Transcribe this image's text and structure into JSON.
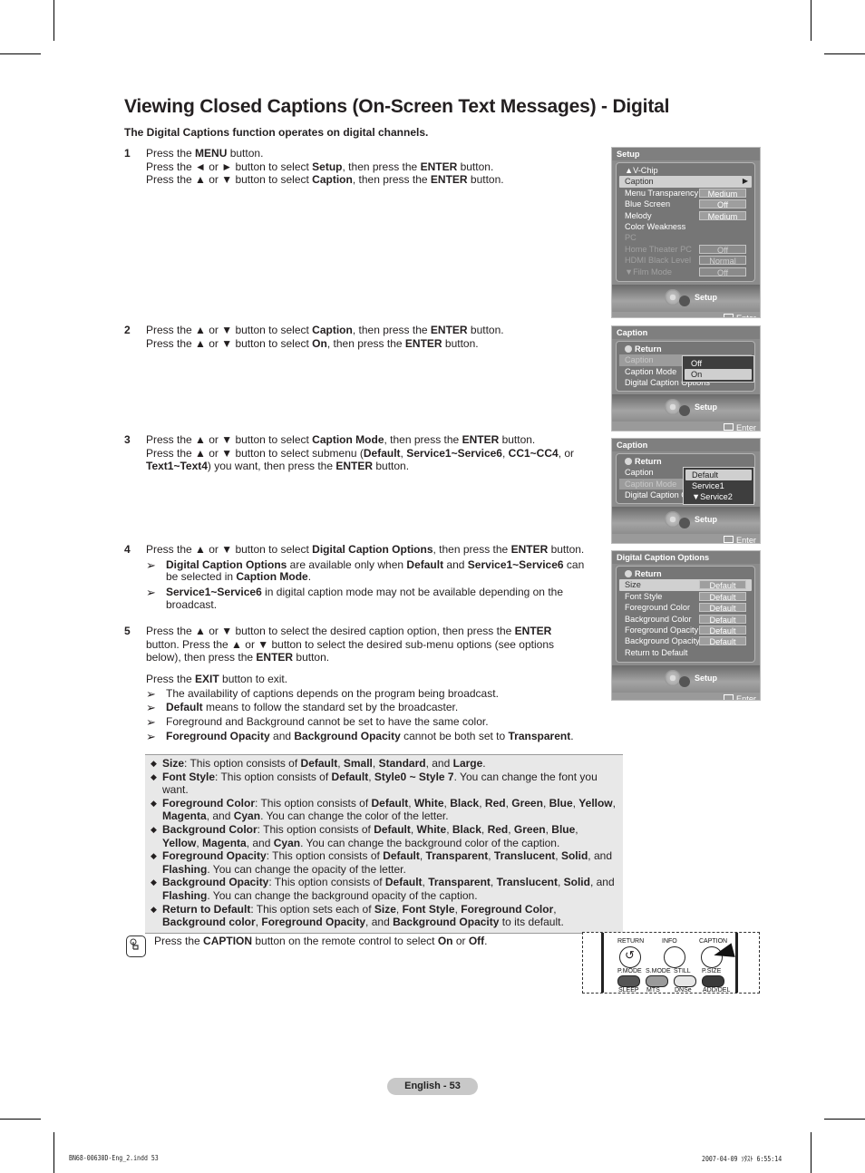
{
  "title": "Viewing Closed Captions (On-Screen Text Messages) - Digital",
  "subtitle": "The Digital Captions function operates on digital channels.",
  "steps": [
    {
      "num": "1",
      "lines": [
        [
          "Press the ",
          {
            "b": "MENU"
          },
          " button."
        ],
        [
          "Press the ◄ or ► button to select ",
          {
            "b": "Setup"
          },
          ", then press the ",
          {
            "b": "ENTER"
          },
          " button."
        ],
        [
          "Press the ▲ or ▼ button to select ",
          {
            "b": "Caption"
          },
          ", then press the ",
          {
            "b": "ENTER"
          },
          " button."
        ]
      ]
    },
    {
      "num": "2",
      "lines": [
        [
          "Press the ▲ or ▼ button to select ",
          {
            "b": "Caption"
          },
          ", then press the ",
          {
            "b": "ENTER"
          },
          " button."
        ],
        [
          "Press the ▲ or ▼ button to select ",
          {
            "b": "On"
          },
          ", then press the ",
          {
            "b": "ENTER"
          },
          " button."
        ]
      ]
    },
    {
      "num": "3",
      "lines": [
        [
          "Press the ▲ or ▼ button to select ",
          {
            "b": "Caption Mode"
          },
          ", then press the ",
          {
            "b": "ENTER"
          },
          " button."
        ],
        [
          "Press the ▲ or ▼ button to select submenu (",
          {
            "b": "Default"
          },
          ", ",
          {
            "b": "Service1~Service6"
          },
          ", ",
          {
            "b": "CC1~CC4"
          },
          ", or ",
          {
            "b": "Text1~Text4"
          },
          ") you want, then press the ",
          {
            "b": "ENTER"
          },
          " button."
        ]
      ]
    },
    {
      "num": "4",
      "lines": [
        [
          "Press the ▲ or ▼ button to select ",
          {
            "b": "Digital Caption Options"
          },
          ", then press the ",
          {
            "b": "ENTER"
          },
          " button."
        ]
      ],
      "notes": [
        [
          {
            "b": "Digital Caption Options"
          },
          " are available only when ",
          {
            "b": "Default"
          },
          " and ",
          {
            "b": "Service1~Service6"
          },
          " can be selected in ",
          {
            "b": "Caption Mode"
          },
          "."
        ],
        [
          {
            "b": "Service1~Service6"
          },
          " in digital caption mode may not be available depending on the broadcast."
        ]
      ]
    },
    {
      "num": "5",
      "lines": [
        [
          "Press the ▲ or ▼ button to select the desired caption option, then press the ",
          {
            "b": "ENTER"
          },
          " button. Press the ▲ or ▼ button to select the desired sub-menu options (see options below), then press the ",
          {
            "b": "ENTER"
          },
          " button."
        ]
      ]
    }
  ],
  "exit_line": [
    "Press the ",
    {
      "b": "EXIT"
    },
    " button to exit."
  ],
  "exit_notes": [
    [
      "The availability of captions depends on the program being broadcast."
    ],
    [
      {
        "b": "Default"
      },
      " means to follow the standard set by the broadcaster."
    ],
    [
      "Foreground and Background cannot be set to have the same color."
    ],
    [
      {
        "b": "Foreground Opacity"
      },
      " and ",
      {
        "b": "Background Opacity"
      },
      " cannot be both set to ",
      {
        "b": "Transparent"
      },
      "."
    ]
  ],
  "options": [
    [
      {
        "b": "Size"
      },
      ": This option consists of ",
      {
        "b": "Default"
      },
      ", ",
      {
        "b": "Small"
      },
      ", ",
      {
        "b": "Standard"
      },
      ", and ",
      {
        "b": "Large"
      },
      "."
    ],
    [
      {
        "b": "Font Style"
      },
      ": This option consists of ",
      {
        "b": "Default"
      },
      ", ",
      {
        "b": "Style0 ~ Style 7"
      },
      ". You can change the font you want."
    ],
    [
      {
        "b": "Foreground Color"
      },
      ": This option consists of ",
      {
        "b": "Default"
      },
      ", ",
      {
        "b": "White"
      },
      ", ",
      {
        "b": "Black"
      },
      ", ",
      {
        "b": "Red"
      },
      ", ",
      {
        "b": "Green"
      },
      ", ",
      {
        "b": "Blue"
      },
      ", ",
      {
        "b": "Yellow"
      },
      ", ",
      {
        "b": "Magenta"
      },
      ", and ",
      {
        "b": "Cyan"
      },
      ". You can change the color of the letter."
    ],
    [
      {
        "b": "Background Color"
      },
      ": This option consists of ",
      {
        "b": "Default"
      },
      ", ",
      {
        "b": "White"
      },
      ", ",
      {
        "b": "Black"
      },
      ", ",
      {
        "b": "Red"
      },
      ", ",
      {
        "b": "Green"
      },
      ", ",
      {
        "b": "Blue"
      },
      ", ",
      {
        "b": "Yellow"
      },
      ", ",
      {
        "b": "Magenta"
      },
      ", and ",
      {
        "b": "Cyan"
      },
      ". You can change the background color of the caption."
    ],
    [
      {
        "b": "Foreground Opacity"
      },
      ": This option consists of ",
      {
        "b": "Default"
      },
      ", ",
      {
        "b": "Transparent"
      },
      ", ",
      {
        "b": "Translucent"
      },
      ", ",
      {
        "b": "Solid"
      },
      ", and ",
      {
        "b": "Flashing"
      },
      ". You can change the opacity of the letter."
    ],
    [
      {
        "b": "Background Opacity"
      },
      ": This option consists of ",
      {
        "b": "Default"
      },
      ", ",
      {
        "b": "Transparent"
      },
      ", ",
      {
        "b": "Translucent"
      },
      ", ",
      {
        "b": "Solid"
      },
      ", and ",
      {
        "b": "Flashing"
      },
      ". You can change the background opacity of the caption."
    ],
    [
      {
        "b": "Return to Default"
      },
      ": This option sets each of ",
      {
        "b": "Size"
      },
      ", ",
      {
        "b": "Font Style"
      },
      ", ",
      {
        "b": "Foreground Color"
      },
      ", ",
      {
        "b": "Background color"
      },
      ", ",
      {
        "b": "Foreground Opacity"
      },
      ", and ",
      {
        "b": "Background Opacity"
      },
      " to its default."
    ]
  ],
  "tip": [
    "Press the ",
    {
      "b": "CAPTION"
    },
    " button on the remote control to select ",
    {
      "b": "On"
    },
    " or ",
    {
      "b": "Off"
    },
    "."
  ],
  "tip_icon": "hand-pointer-icon",
  "osd": {
    "band_label": "Setup",
    "enter_label": "Enter",
    "return_label": "Return",
    "setup": {
      "header": "Setup",
      "rows": [
        {
          "label": "▲V-Chip",
          "value": null,
          "state": "normal"
        },
        {
          "label": "Caption",
          "value": null,
          "state": "selected",
          "arrow": "▶"
        },
        {
          "label": "Menu Transparency",
          "value": "Medium",
          "state": "normal"
        },
        {
          "label": "Blue Screen",
          "value": "Off",
          "state": "normal"
        },
        {
          "label": "Melody",
          "value": "Medium",
          "state": "normal"
        },
        {
          "label": "Color Weakness",
          "value": null,
          "state": "normal"
        },
        {
          "label": "PC",
          "value": null,
          "state": "disabled"
        },
        {
          "label": "Home Theater PC",
          "value": "Off",
          "state": "disabled"
        },
        {
          "label": "HDMI Black Level",
          "value": "Normal",
          "state": "disabled"
        },
        {
          "label": "▼Film Mode",
          "value": "Off",
          "state": "disabled"
        }
      ]
    },
    "caption1": {
      "header": "Caption",
      "rows": [
        {
          "label": "Caption",
          "state": "highlight-dim"
        },
        {
          "label": "Caption Mode",
          "state": "normal"
        },
        {
          "label": "Digital Caption Options",
          "state": "normal"
        }
      ],
      "popup": [
        {
          "label": "Off",
          "selected": false
        },
        {
          "label": "On",
          "selected": true
        }
      ]
    },
    "caption2": {
      "header": "Caption",
      "rows": [
        {
          "label": "Caption",
          "state": "normal"
        },
        {
          "label": "Caption Mode",
          "state": "highlight-dim"
        },
        {
          "label": "Digital Caption Options",
          "state": "normal"
        }
      ],
      "popup": [
        {
          "label": "Default",
          "selected": true
        },
        {
          "label": "Service1",
          "selected": false
        },
        {
          "label": "▼Service2",
          "selected": false
        }
      ]
    },
    "dco": {
      "header": "Digital Caption Options",
      "rows": [
        {
          "label": "Size",
          "value": "Default",
          "state": "selected"
        },
        {
          "label": "Font Style",
          "value": "Default",
          "state": "normal"
        },
        {
          "label": "Foreground Color",
          "value": "Default",
          "state": "normal"
        },
        {
          "label": "Background Color",
          "value": "Default",
          "state": "normal"
        },
        {
          "label": "Foreground Opacity",
          "value": "Default",
          "state": "normal"
        },
        {
          "label": "Background Opacity",
          "value": "Default",
          "state": "normal"
        },
        {
          "label": "Return to Default",
          "value": null,
          "state": "normal"
        }
      ]
    }
  },
  "remote": {
    "top_labels": [
      "RETURN",
      "INFO",
      "CAPTION"
    ],
    "mid_labels": [
      "P.MODE",
      "S.MODE",
      "STILL",
      "P.SIZE"
    ],
    "bottom_labels": [
      "SLEEP",
      "MTS",
      "DNSe",
      "ADD/DEL"
    ],
    "button_colors": [
      "#555555",
      "#9a9a9a",
      "#e6e6e6",
      "#3a3a3a"
    ]
  },
  "footer": {
    "page_label": "English - 53",
    "slug_left": "BN68-00630D-Eng_2.indd   53",
    "slug_right": "2007-04-09   ｿﾀｽﾄ 6:55:14"
  }
}
